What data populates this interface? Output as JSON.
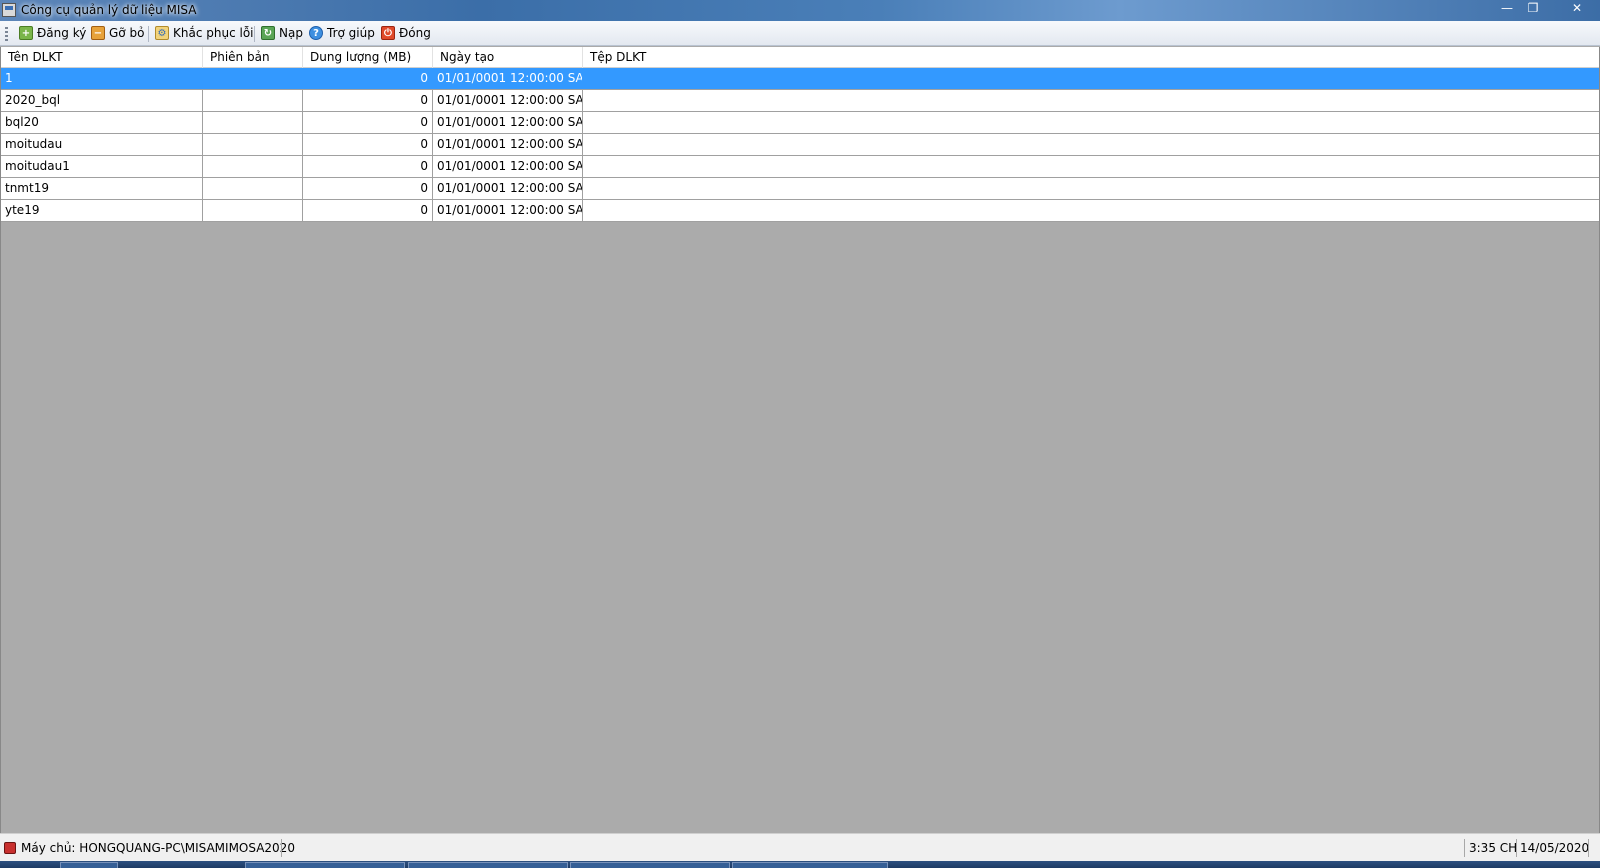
{
  "window": {
    "title": "Công cụ quản lý dữ liệu MISA",
    "controls": {
      "minimize": "—",
      "restore": "❐",
      "close": "✕"
    }
  },
  "toolbar": {
    "register": {
      "label": "Đăng ký",
      "icon": "plus-icon"
    },
    "remove": {
      "label": "Gỡ bỏ",
      "icon": "remove-icon"
    },
    "repair": {
      "label": "Khắc phục lỗi",
      "icon": "repair-icon"
    },
    "reload": {
      "label": "Nạp",
      "icon": "reload-icon"
    },
    "help": {
      "label": "Trợ giúp",
      "icon": "help-icon"
    },
    "close": {
      "label": "Đóng",
      "icon": "power-icon"
    }
  },
  "table": {
    "columns": [
      "Tên DLKT",
      "Phiên bản",
      "Dung lượng (MB)",
      "Ngày tạo",
      "Tệp DLKT"
    ],
    "rows": [
      {
        "name": "1",
        "version": "",
        "size": "0",
        "created": "01/01/0001 12:00:00 SA",
        "file": "",
        "selected": true
      },
      {
        "name": "2020_bql",
        "version": "",
        "size": "0",
        "created": "01/01/0001 12:00:00 SA",
        "file": ""
      },
      {
        "name": "bql20",
        "version": "",
        "size": "0",
        "created": "01/01/0001 12:00:00 SA",
        "file": ""
      },
      {
        "name": "moitudau",
        "version": "",
        "size": "0",
        "created": "01/01/0001 12:00:00 SA",
        "file": ""
      },
      {
        "name": "moitudau1",
        "version": "",
        "size": "0",
        "created": "01/01/0001 12:00:00 SA",
        "file": ""
      },
      {
        "name": "tnmt19",
        "version": "",
        "size": "0",
        "created": "01/01/0001 12:00:00 SA",
        "file": ""
      },
      {
        "name": "yte19",
        "version": "",
        "size": "0",
        "created": "01/01/0001 12:00:00 SA",
        "file": ""
      }
    ]
  },
  "status": {
    "server": "Máy chủ: HONGQUANG-PC\\MISAMIMOSA2020",
    "time": "3:35 CH",
    "date": "14/05/2020"
  },
  "colors": {
    "selected_row": "#3399ff",
    "empty_area": "#ababab"
  }
}
